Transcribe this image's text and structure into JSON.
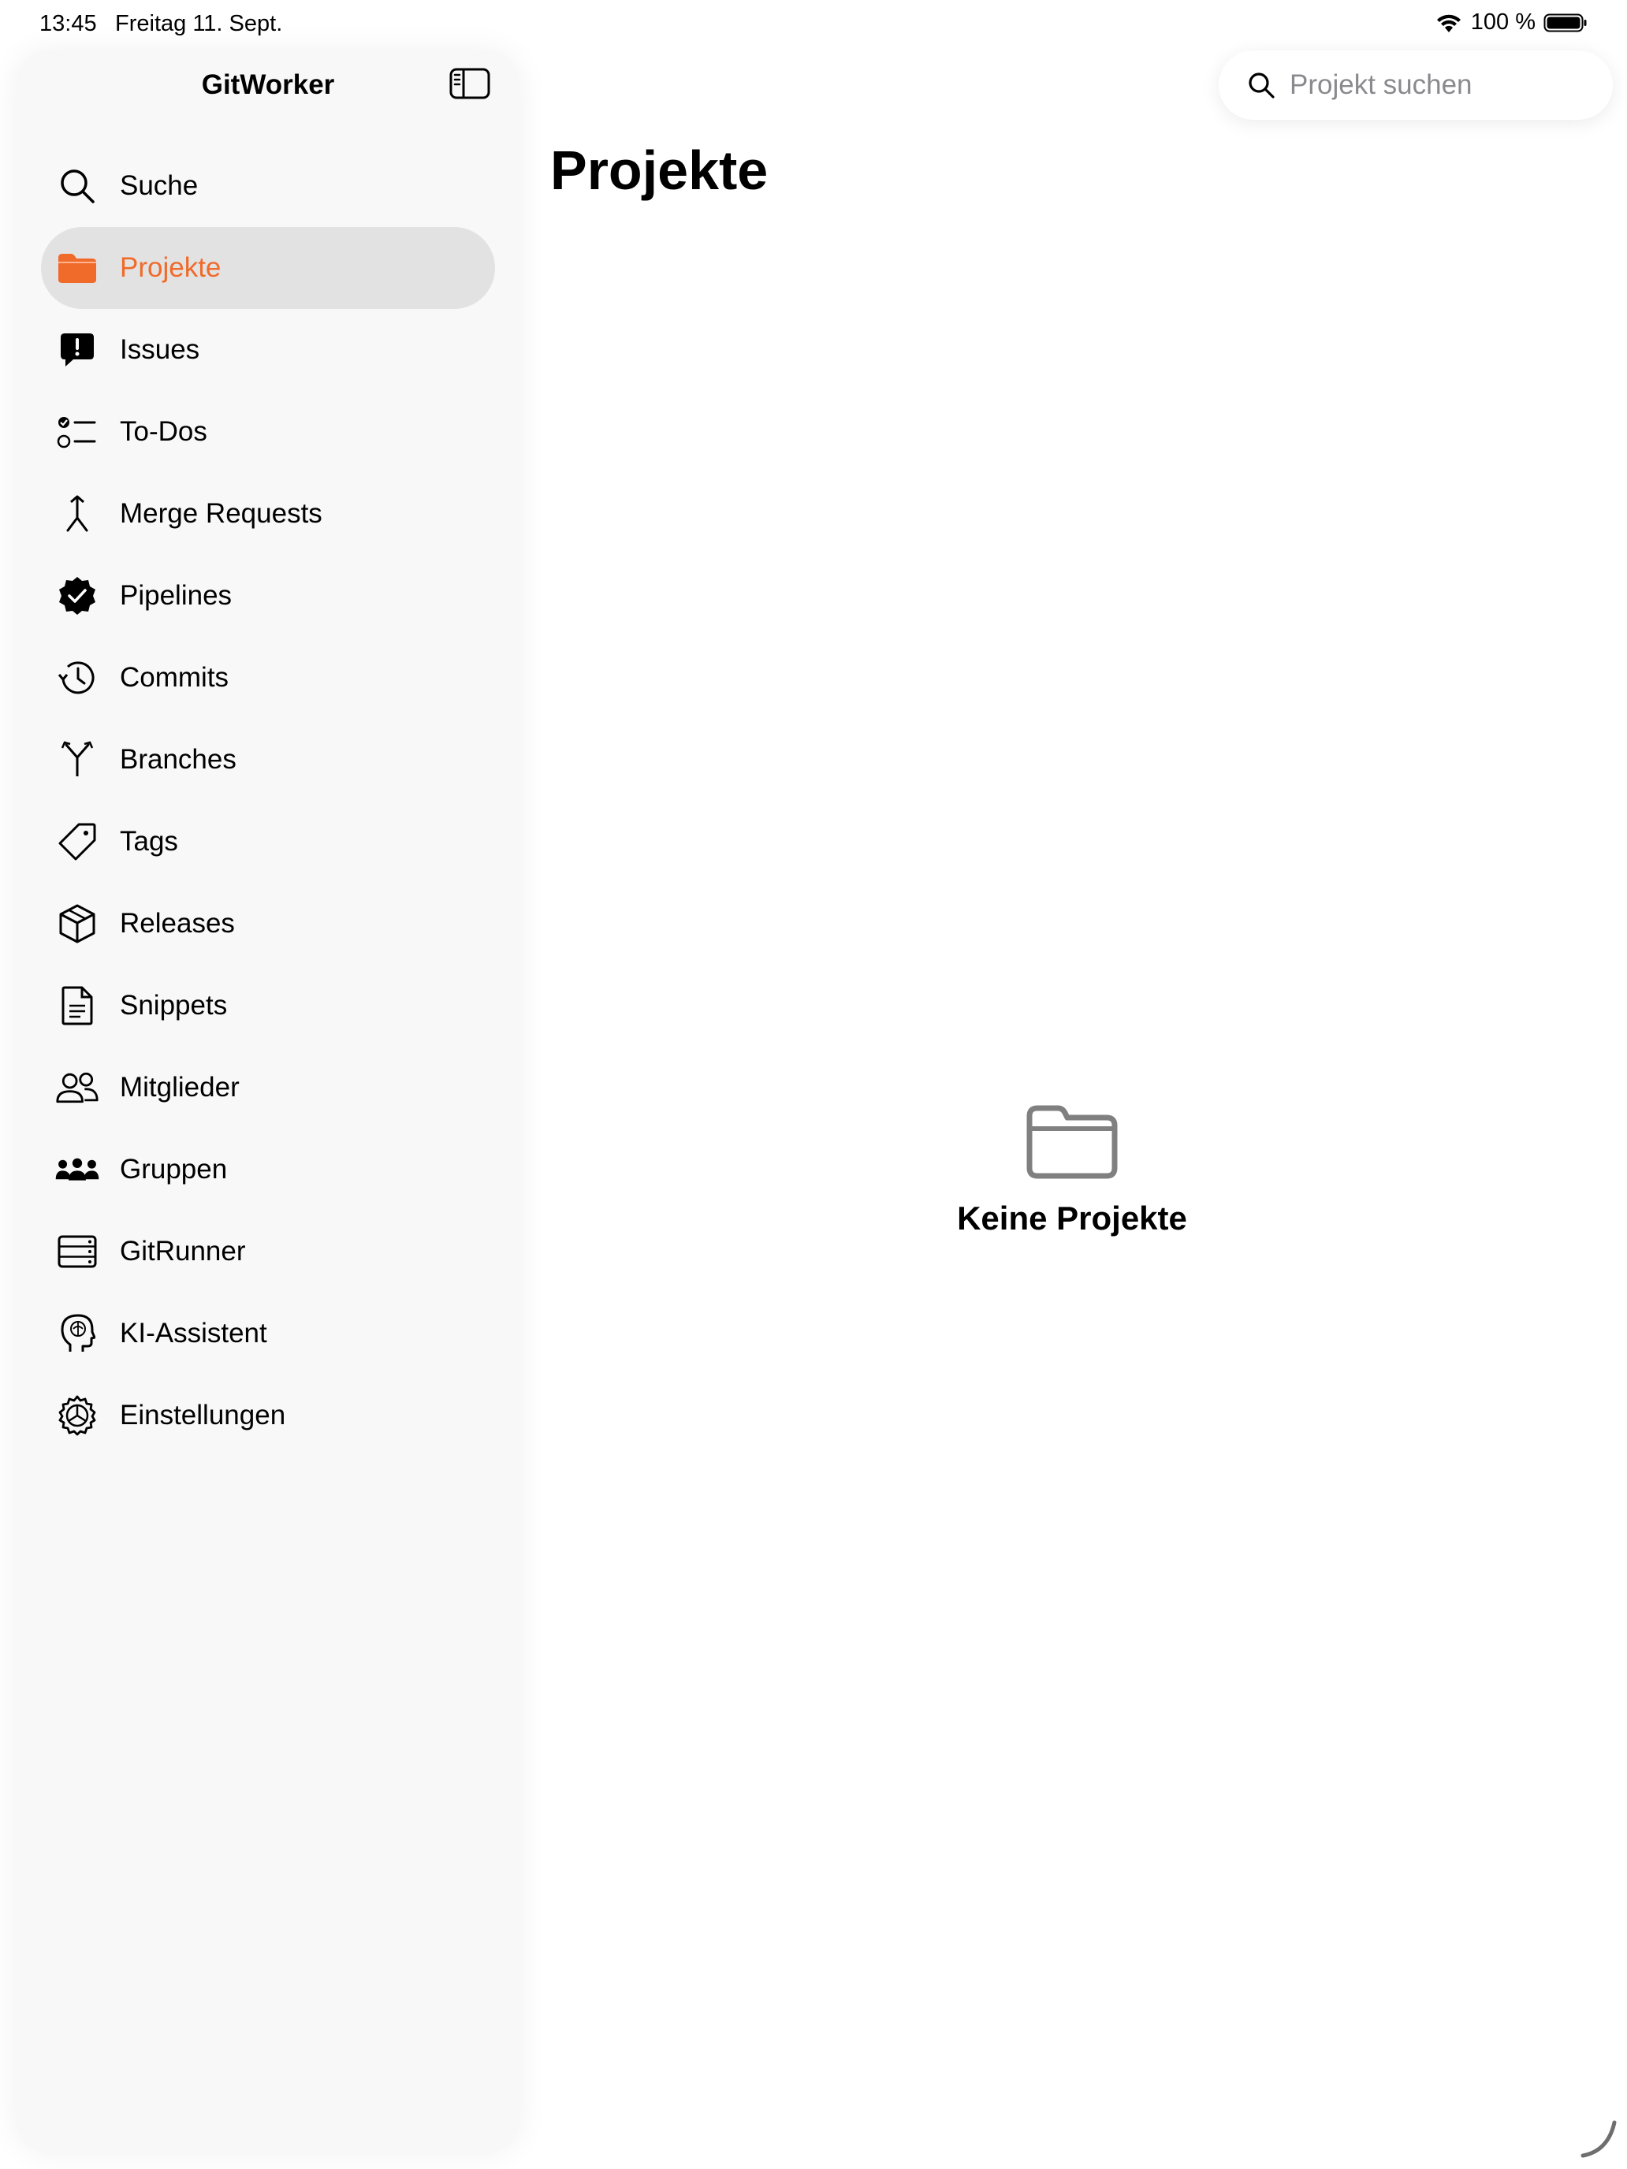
{
  "status_bar": {
    "time": "13:45",
    "date": "Freitag 11. Sept.",
    "battery_percent": "100 %",
    "wifi_icon": "wifi-icon",
    "battery_icon": "battery-icon"
  },
  "sidebar": {
    "title": "GitWorker",
    "toggle_icon": "sidebar-toggle-icon",
    "items": [
      {
        "label": "Suche",
        "icon": "magnifyingglass-icon",
        "active": false
      },
      {
        "label": "Projekte",
        "icon": "folder-icon",
        "active": true
      },
      {
        "label": "Issues",
        "icon": "exclamation-bubble-icon",
        "active": false
      },
      {
        "label": "To-Dos",
        "icon": "checklist-icon",
        "active": false
      },
      {
        "label": "Merge Requests",
        "icon": "merge-icon",
        "active": false
      },
      {
        "label": "Pipelines",
        "icon": "checkmark-seal-icon",
        "active": false
      },
      {
        "label": "Commits",
        "icon": "history-clock-icon",
        "active": false
      },
      {
        "label": "Branches",
        "icon": "branch-icon",
        "active": false
      },
      {
        "label": "Tags",
        "icon": "tag-icon",
        "active": false
      },
      {
        "label": "Releases",
        "icon": "cube-box-icon",
        "active": false
      },
      {
        "label": "Snippets",
        "icon": "document-icon",
        "active": false
      },
      {
        "label": "Mitglieder",
        "icon": "two-people-icon",
        "active": false
      },
      {
        "label": "Gruppen",
        "icon": "three-people-icon",
        "active": false
      },
      {
        "label": "GitRunner",
        "icon": "server-rack-icon",
        "active": false
      },
      {
        "label": "KI-Assistent",
        "icon": "brain-head-icon",
        "active": false
      },
      {
        "label": "Einstellungen",
        "icon": "gear-icon",
        "active": false
      }
    ]
  },
  "search": {
    "placeholder": "Projekt suchen",
    "icon": "search-icon"
  },
  "main": {
    "title": "Projekte",
    "empty_state": {
      "icon": "folder-outline-icon",
      "label": "Keine Projekte"
    }
  },
  "colors": {
    "accent": "#f06a2a",
    "sidebar_bg": "#f8f8f8",
    "active_row_bg": "#e2e2e2",
    "placeholder": "#8a8a8e"
  }
}
